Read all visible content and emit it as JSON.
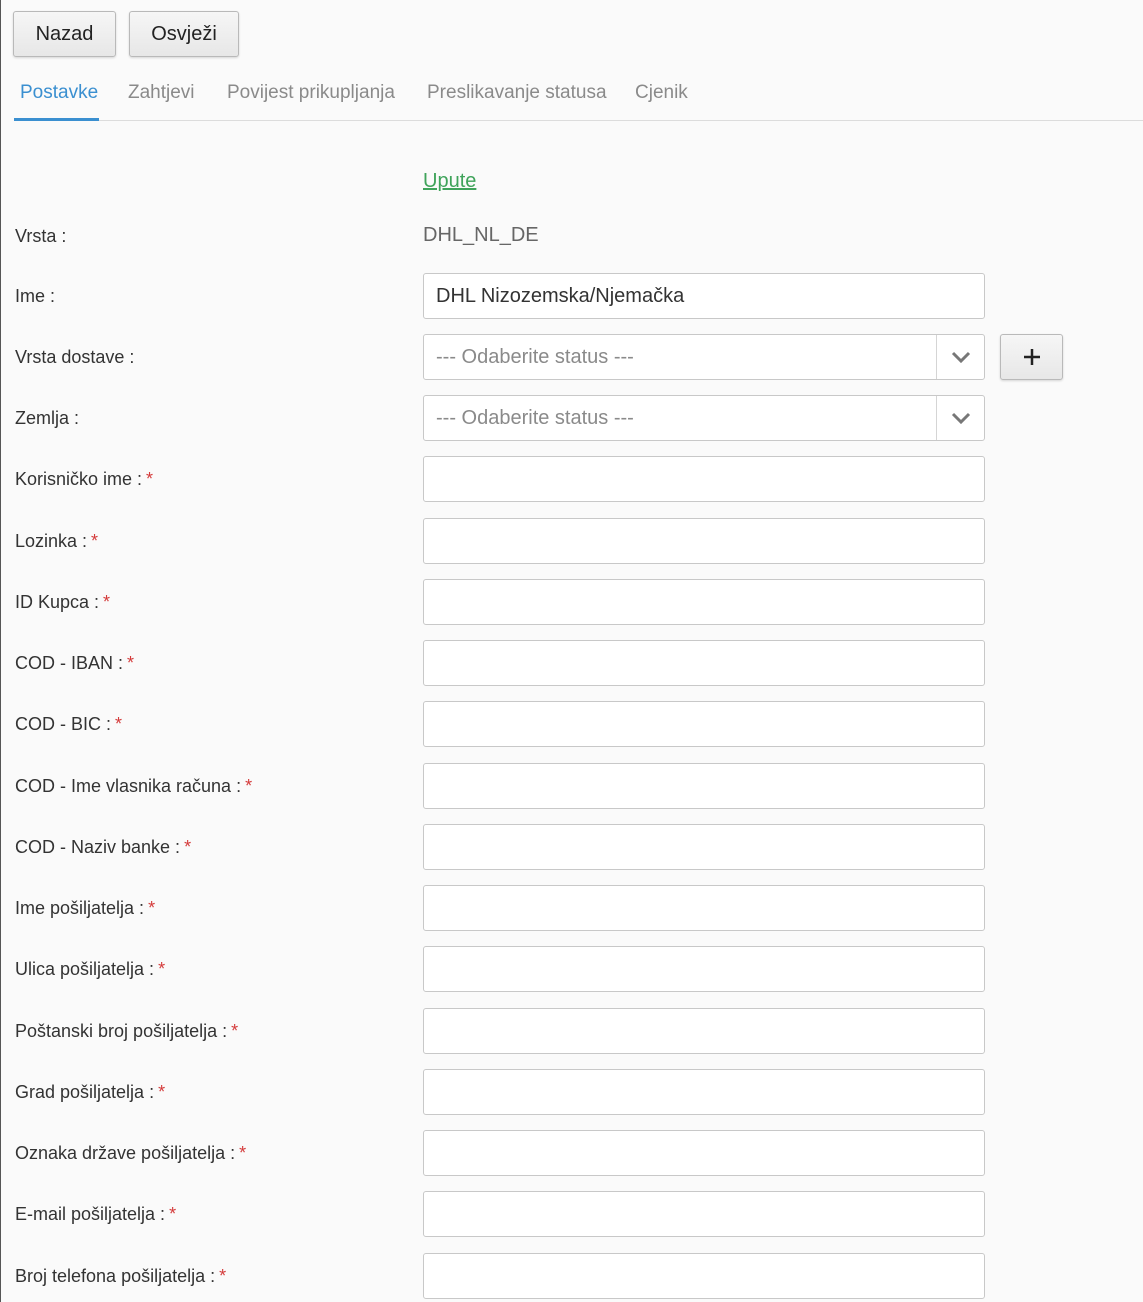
{
  "toolbar": {
    "back_label": "Nazad",
    "refresh_label": "Osvježi"
  },
  "tabs": [
    {
      "label": "Postavke",
      "active": true
    },
    {
      "label": "Zahtjevi",
      "active": false
    },
    {
      "label": "Povijest prikupljanja",
      "active": false
    },
    {
      "label": "Preslikavanje statusa",
      "active": false
    },
    {
      "label": "Cjenik",
      "active": false
    }
  ],
  "form": {
    "upute_link": "Upute",
    "vrsta": {
      "label": "Vrsta :",
      "value": "DHL_NL_DE"
    },
    "ime": {
      "label": "Ime :",
      "value": "DHL Nizozemska/Njemačka"
    },
    "vrsta_dostave": {
      "label": "Vrsta dostave :",
      "selected": "--- Odaberite status ---"
    },
    "zemlja": {
      "label": "Zemlja :",
      "selected": "--- Odaberite status ---"
    },
    "required_mark": "*",
    "fields": [
      {
        "label": "Korisničko ime :",
        "value": ""
      },
      {
        "label": "Lozinka :",
        "value": ""
      },
      {
        "label": "ID Kupca :",
        "value": ""
      },
      {
        "label": "COD - IBAN :",
        "value": ""
      },
      {
        "label": "COD - BIC :",
        "value": ""
      },
      {
        "label": "COD - Ime vlasnika računa :",
        "value": ""
      },
      {
        "label": "COD - Naziv banke :",
        "value": ""
      },
      {
        "label": "Ime pošiljatelja :",
        "value": ""
      },
      {
        "label": "Ulica pošiljatelja :",
        "value": ""
      },
      {
        "label": "Poštanski broj pošiljatelja :",
        "value": ""
      },
      {
        "label": "Grad pošiljatelja :",
        "value": ""
      },
      {
        "label": "Oznaka države pošiljatelja :",
        "value": ""
      },
      {
        "label": "E-mail pošiljatelja :",
        "value": ""
      },
      {
        "label": "Broj telefona pošiljatelja :",
        "value": ""
      }
    ]
  },
  "colors": {
    "accent": "#3a8fd0",
    "link": "#3fa35a",
    "required": "#d43a3a"
  }
}
